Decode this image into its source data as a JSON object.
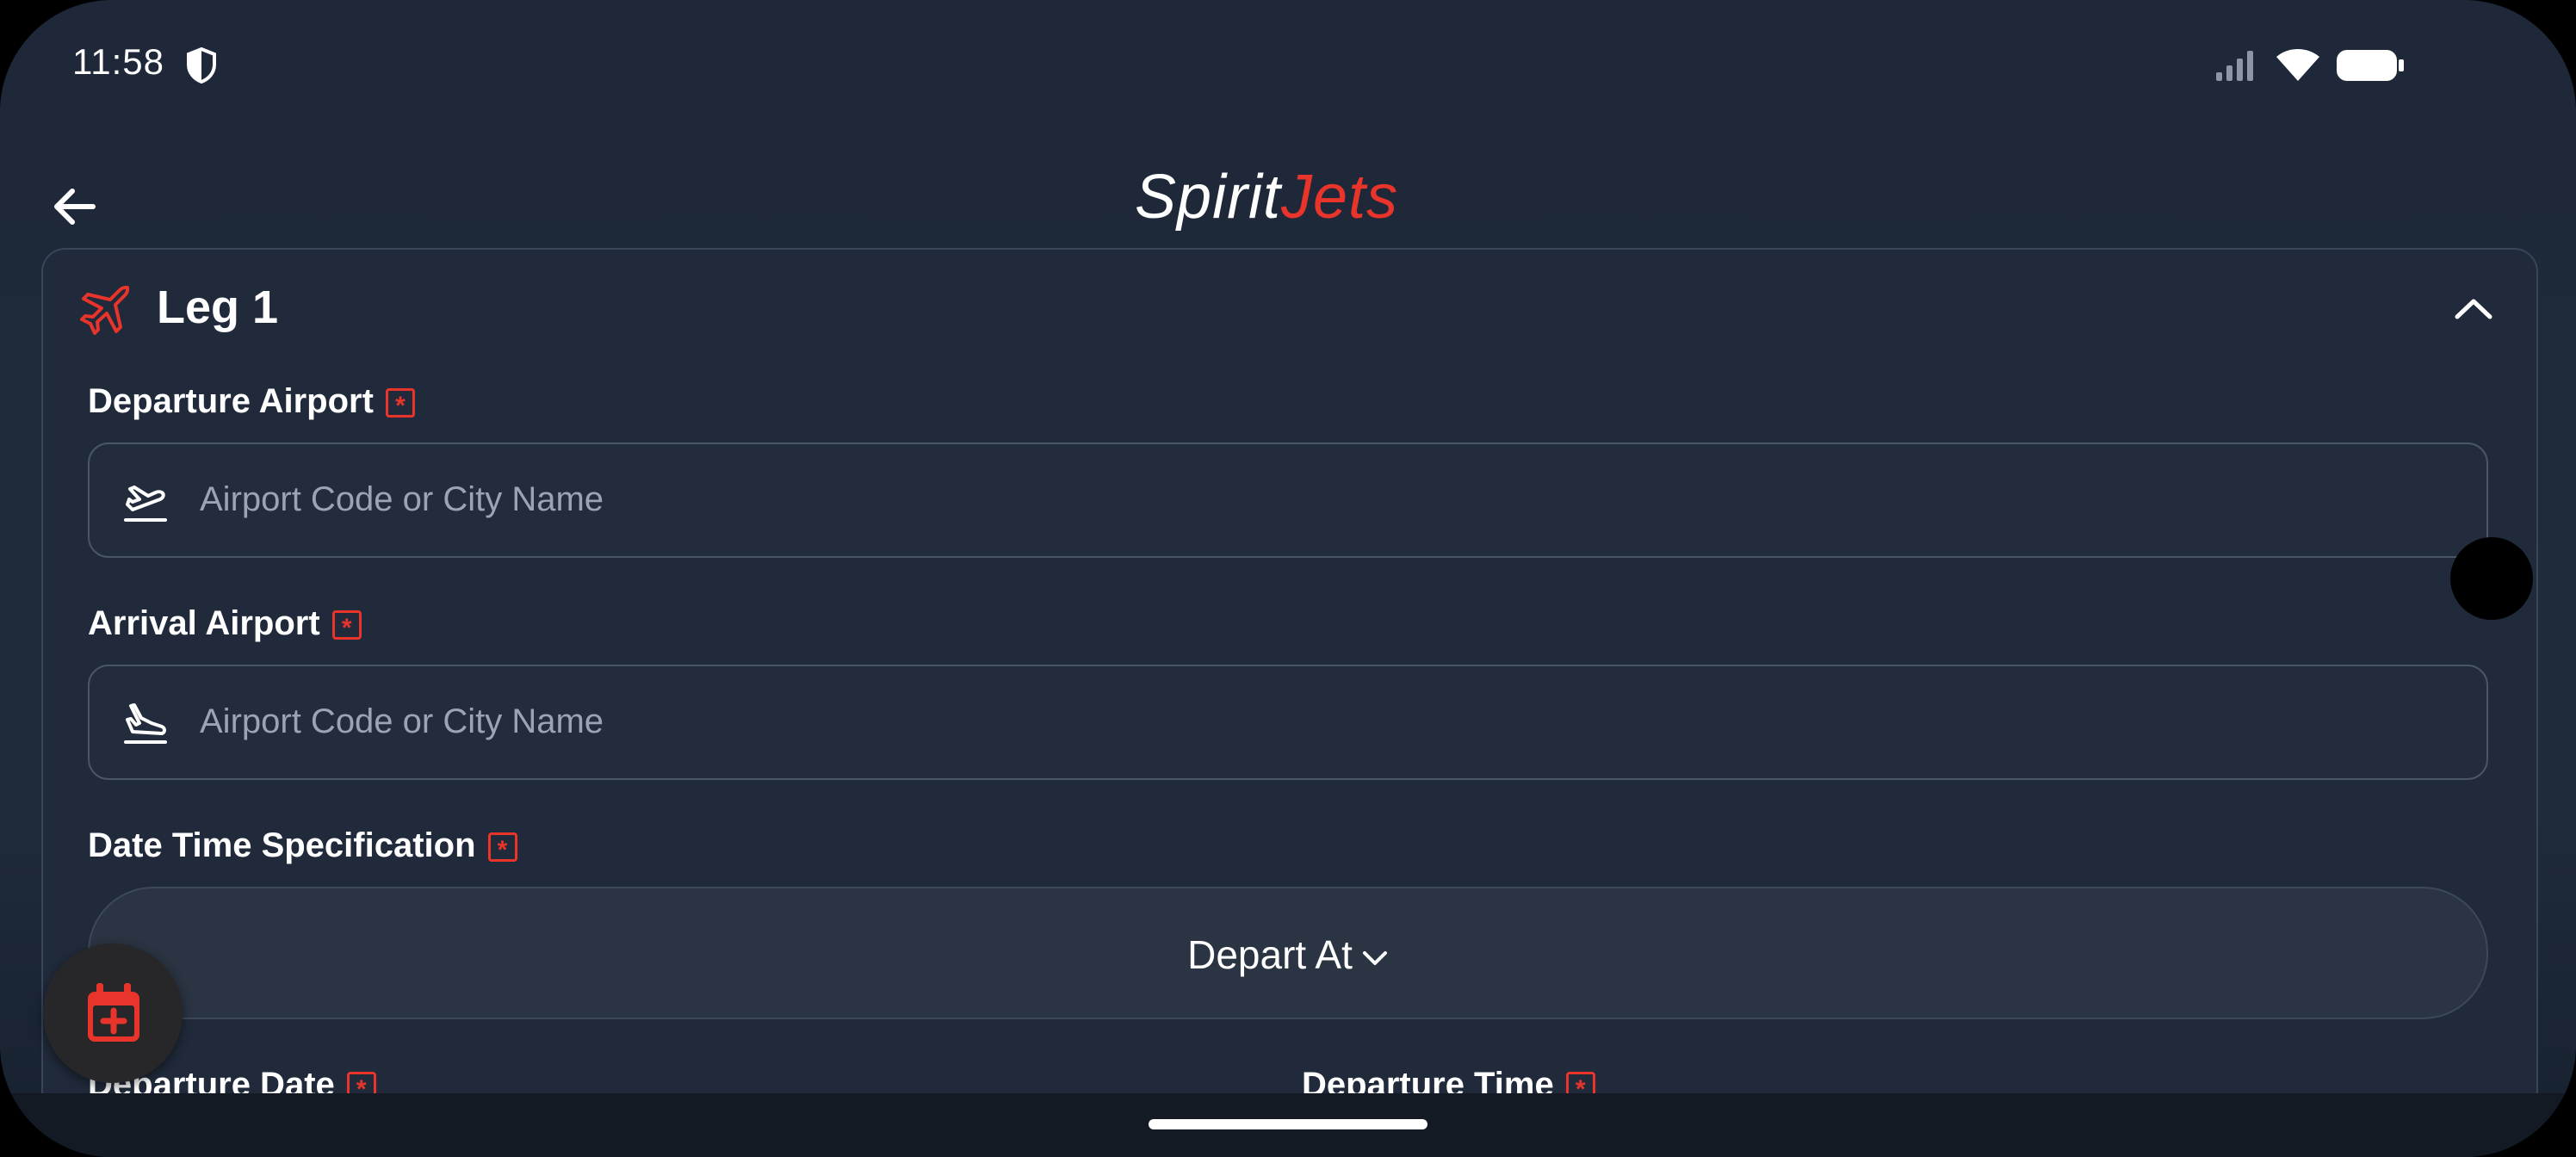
{
  "status_bar": {
    "time": "11:58",
    "icons": [
      "shield-icon",
      "signal-icon",
      "wifi-icon",
      "battery-icon"
    ]
  },
  "header": {
    "logo_part1": "Spirit",
    "logo_part2": "Jets",
    "back_icon": "arrow-left-icon",
    "colors": {
      "accent": "#e8342b",
      "background": "#1f2a3a"
    }
  },
  "leg": {
    "title": "Leg 1",
    "icon": "airplane-icon",
    "collapse_icon": "chevron-up-icon"
  },
  "fields": {
    "departure_airport": {
      "label": "Departure Airport",
      "required": "*",
      "placeholder": "Airport Code or City Name",
      "icon": "takeoff-icon"
    },
    "arrival_airport": {
      "label": "Arrival Airport",
      "required": "*",
      "placeholder": "Airport Code or City Name",
      "icon": "landing-icon"
    },
    "date_time_spec": {
      "label": "Date Time Specification",
      "required": "*",
      "selected": "Depart At"
    },
    "departure_date": {
      "label": "Departure Date",
      "required": "*"
    },
    "departure_time": {
      "label": "Departure Time",
      "required": "*"
    }
  },
  "fab": {
    "icon": "calendar-add-icon"
  }
}
